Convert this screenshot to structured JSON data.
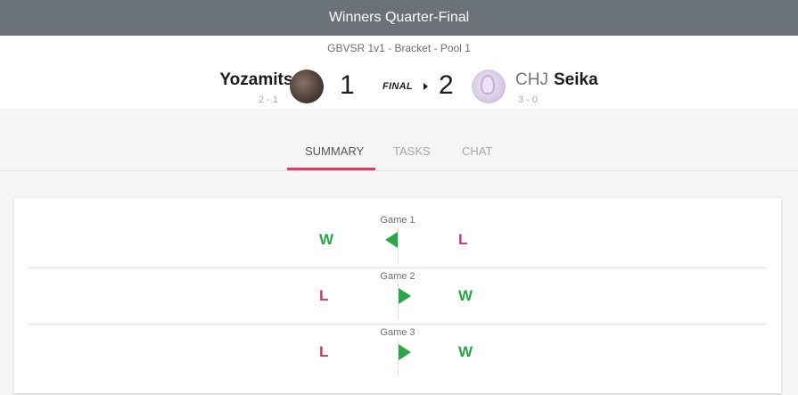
{
  "header": {
    "round": "Winners Quarter-Final",
    "bracket": "GBVSR 1v1 - Bracket - Pool 1",
    "status": "FINAL"
  },
  "player1": {
    "name": "Yozamitsu",
    "record": "2 - 1",
    "score": "1",
    "avatar": "player-avatar"
  },
  "player2": {
    "prefix": "CHJ",
    "name": "Seika",
    "record": "3 - 0",
    "score": "2",
    "avatar": "player-avatar"
  },
  "tabs": [
    {
      "label": "SUMMARY",
      "active": true
    },
    {
      "label": "TASKS",
      "active": false
    },
    {
      "label": "CHAT",
      "active": false
    }
  ],
  "games": [
    {
      "label": "Game 1",
      "left": "W",
      "right": "L",
      "winner": "left"
    },
    {
      "label": "Game 2",
      "left": "L",
      "right": "W",
      "winner": "right"
    },
    {
      "label": "Game 3",
      "left": "L",
      "right": "W",
      "winner": "right"
    }
  ],
  "colors": {
    "win": "#27a745",
    "loss": "#dd2f63",
    "accent": "#e03c6a",
    "topbar": "#6b7178"
  }
}
